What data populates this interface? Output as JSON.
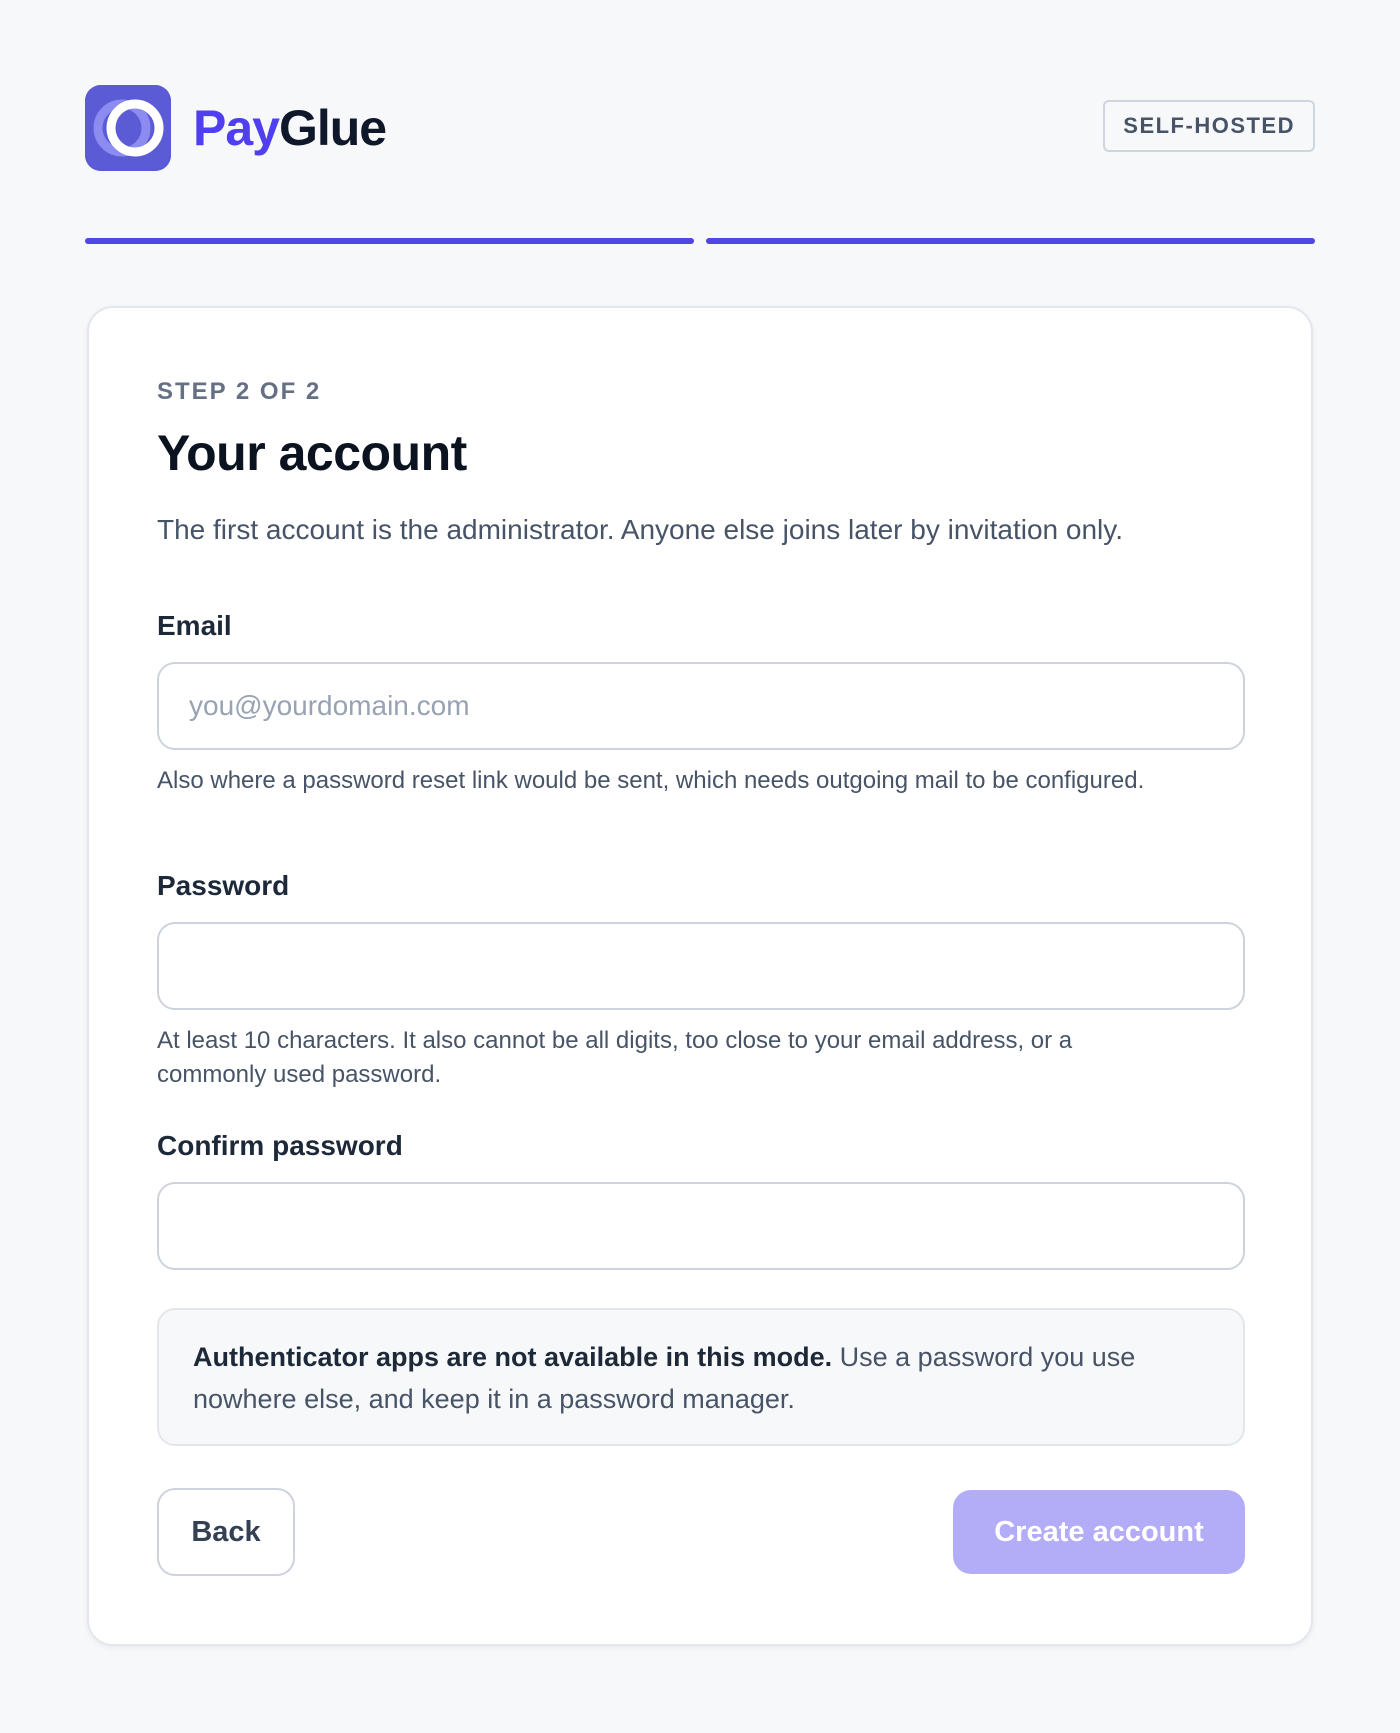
{
  "brand": {
    "name_part1": "Pay",
    "name_part2": "Glue",
    "primary_color": "#4f3ff0",
    "logo_icon": "payglue-logo-icon"
  },
  "header": {
    "badge": "SELF-HOSTED"
  },
  "progress": {
    "completed_steps": 2,
    "total_steps": 2,
    "color": "#4f46e5"
  },
  "card": {
    "step_label": "STEP 2 OF 2",
    "title": "Your account",
    "subtitle": "The first account is the administrator. Anyone else joins later by invitation only."
  },
  "form": {
    "email": {
      "label": "Email",
      "placeholder": "you@yourdomain.com",
      "value": "",
      "hint": "Also where a password reset link would be sent, which needs outgoing mail to be configured."
    },
    "password": {
      "label": "Password",
      "value": "",
      "hint": "At least 10 characters. It also cannot be all digits, too close to your email address, or a commonly used password."
    },
    "confirm_password": {
      "label": "Confirm password",
      "value": ""
    }
  },
  "notice": {
    "bold": "Authenticator apps are not available in this mode.",
    "text": " Use a password you use nowhere else, and keep it in a password manager."
  },
  "actions": {
    "back_label": "Back",
    "create_label": "Create account",
    "create_disabled_color": "#b3acf7"
  }
}
